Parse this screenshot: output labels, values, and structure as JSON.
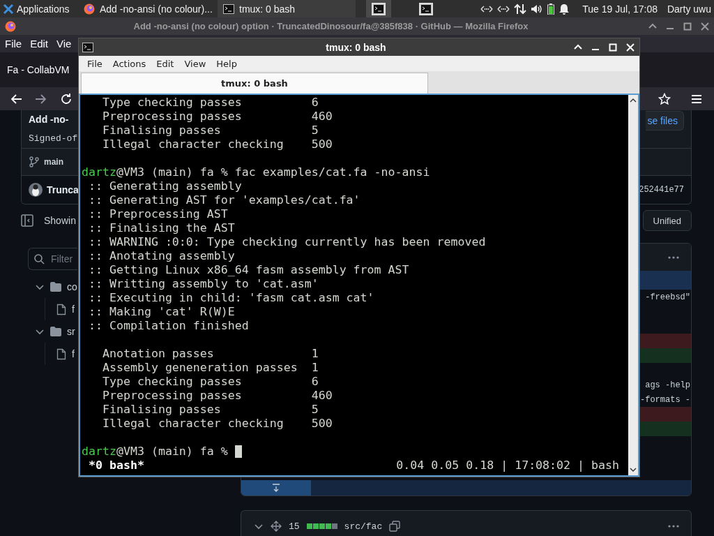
{
  "taskbar": {
    "app_menu": "Applications",
    "tasks": [
      {
        "kind": "browser",
        "label": "Add -no-ansi (no colour)...",
        "selected": false
      },
      {
        "kind": "terminal",
        "label": "tmux: 0 bash",
        "selected": true
      }
    ],
    "workspaces": [
      {
        "selected": true
      },
      {
        "selected": false
      }
    ],
    "clock": "Tue 19 Jul, 17:08",
    "user": "Darty uwu"
  },
  "browser": {
    "title": "Add -no-ansi (no colour) option · TruncatedDinosour/fa@385f838 · GitHub — Mozilla Firefox",
    "menu": [
      "File",
      "Edit",
      "Vie"
    ],
    "tab": "Fa - CollabVM",
    "commit": {
      "title": "Add -no-",
      "browse_button": "se files",
      "message": "Signed-of",
      "branch": "main",
      "author": "Trunca",
      "hash": "252441e77"
    },
    "showing": "Showin",
    "view_button": "Unified",
    "filter_placeholder": "Filter",
    "tree": [
      {
        "kind": "folder",
        "label": "co",
        "expanded": true,
        "children": [
          {
            "kind": "file",
            "label": "f"
          }
        ]
      },
      {
        "kind": "folder",
        "label": "sr",
        "expanded": true,
        "children": [
          {
            "kind": "file",
            "label": "f"
          }
        ]
      }
    ],
    "diff_lines": [
      {
        "kind": "context",
        "text": "-freebsd\""
      },
      {
        "kind": "context"
      },
      {
        "kind": "context"
      },
      {
        "kind": "deleted"
      },
      {
        "kind": "added"
      },
      {
        "kind": "context"
      },
      {
        "kind": "context",
        "text": "ags -help"
      },
      {
        "kind": "context",
        "text": "-formats -"
      },
      {
        "kind": "deleted"
      },
      {
        "kind": "added"
      },
      {
        "kind": "context"
      },
      {
        "kind": "context"
      },
      {
        "kind": "context"
      }
    ],
    "next_file": {
      "expanded": true,
      "changes": "15",
      "diffstat": [
        {
          "kind": "added"
        },
        {
          "kind": "added"
        },
        {
          "kind": "added"
        },
        {
          "kind": "added"
        },
        {
          "kind": "neutral"
        }
      ],
      "path": "src/fac"
    }
  },
  "terminal": {
    "title": "tmux: 0 bash",
    "menu": [
      "File",
      "Actions",
      "Edit",
      "View",
      "Help"
    ],
    "tabs": [
      {
        "label": "tmux: 0 bash",
        "selected": true
      }
    ],
    "lines": [
      {
        "kind": "stat",
        "label": "Type checking passes",
        "value": "6"
      },
      {
        "kind": "stat",
        "label": "Preprocessing passes",
        "value": "460"
      },
      {
        "kind": "stat",
        "label": "Finalising passes",
        "value": "5"
      },
      {
        "kind": "stat",
        "label": "Illegal character checking",
        "value": "500"
      },
      {
        "kind": "blank"
      },
      {
        "kind": "prompt",
        "user": "dartz",
        "text": "@VM3 (main) fa % fac examples/cat.fa -no-ansi",
        "cursor": false
      },
      {
        "kind": "message",
        "text": ":: Generating assembly"
      },
      {
        "kind": "message",
        "text": ":: Generating AST for 'examples/cat.fa'"
      },
      {
        "kind": "message",
        "text": ":: Preprocessing AST"
      },
      {
        "kind": "message",
        "text": ":: Finalising the AST"
      },
      {
        "kind": "message",
        "text": ":: WARNING :0:0: Type checking currently has been removed"
      },
      {
        "kind": "message",
        "text": ":: Anotating assembly"
      },
      {
        "kind": "message",
        "text": ":: Getting Linux x86_64 fasm assembly from AST"
      },
      {
        "kind": "message",
        "text": ":: Writting assembly to 'cat.asm'"
      },
      {
        "kind": "message",
        "text": ":: Executing in child: 'fasm cat.asm cat'"
      },
      {
        "kind": "message",
        "text": ":: Making 'cat' R(W)E"
      },
      {
        "kind": "message",
        "text": ":: Compilation finished"
      },
      {
        "kind": "blank"
      },
      {
        "kind": "stat",
        "label": "Anotation passes",
        "value": "1"
      },
      {
        "kind": "stat",
        "label": "Assembly geneneration passes",
        "value": "1"
      },
      {
        "kind": "stat",
        "label": "Type checking passes",
        "value": "6"
      },
      {
        "kind": "stat",
        "label": "Preprocessing passes",
        "value": "460"
      },
      {
        "kind": "stat",
        "label": "Finalising passes",
        "value": "5"
      },
      {
        "kind": "stat",
        "label": "Illegal character checking",
        "value": "500"
      },
      {
        "kind": "blank"
      },
      {
        "kind": "prompt",
        "user": "dartz",
        "text": "@VM3 (main) fa %",
        "cursor": true
      }
    ],
    "status_left": "*0 bash*",
    "status_right": "0.04 0.05 0.18 | 17:08:02 | bash"
  }
}
